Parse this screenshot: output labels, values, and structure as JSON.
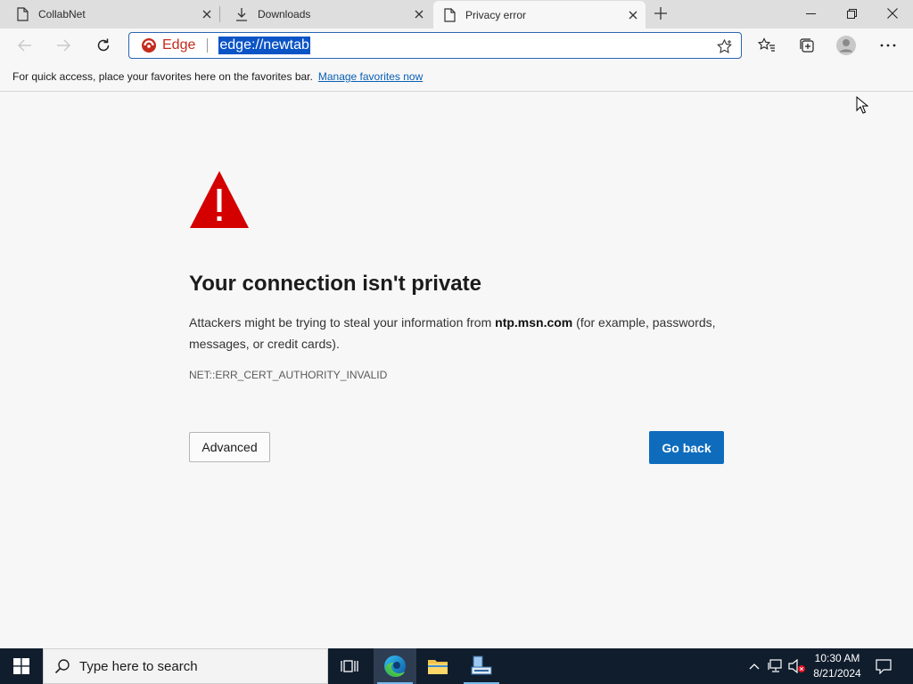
{
  "tabs": [
    {
      "label": "CollabNet",
      "icon": "page-icon"
    },
    {
      "label": "Downloads",
      "icon": "download-icon"
    },
    {
      "label": "Privacy error",
      "icon": "page-icon"
    }
  ],
  "toolbar": {
    "address_badge": "Edge",
    "url": "edge://newtab"
  },
  "favorites_bar": {
    "text": "For quick access, place your favorites here on the favorites bar.",
    "link": "Manage favorites now"
  },
  "error_page": {
    "title": "Your connection isn't private",
    "desc_before": "Attackers might be trying to steal your information from ",
    "desc_host": "ntp.msn.com",
    "desc_after": " (for example, passwords, messages, or credit cards).",
    "error_code": "NET::ERR_CERT_AUTHORITY_INVALID",
    "advanced_label": "Advanced",
    "goback_label": "Go back"
  },
  "taskbar": {
    "search_placeholder": "Type here to search",
    "time": "10:30 AM",
    "date": "8/21/2024"
  },
  "colors": {
    "accent": "#0f6cbd",
    "warning": "#d40000",
    "taskbar": "#101d2d"
  }
}
